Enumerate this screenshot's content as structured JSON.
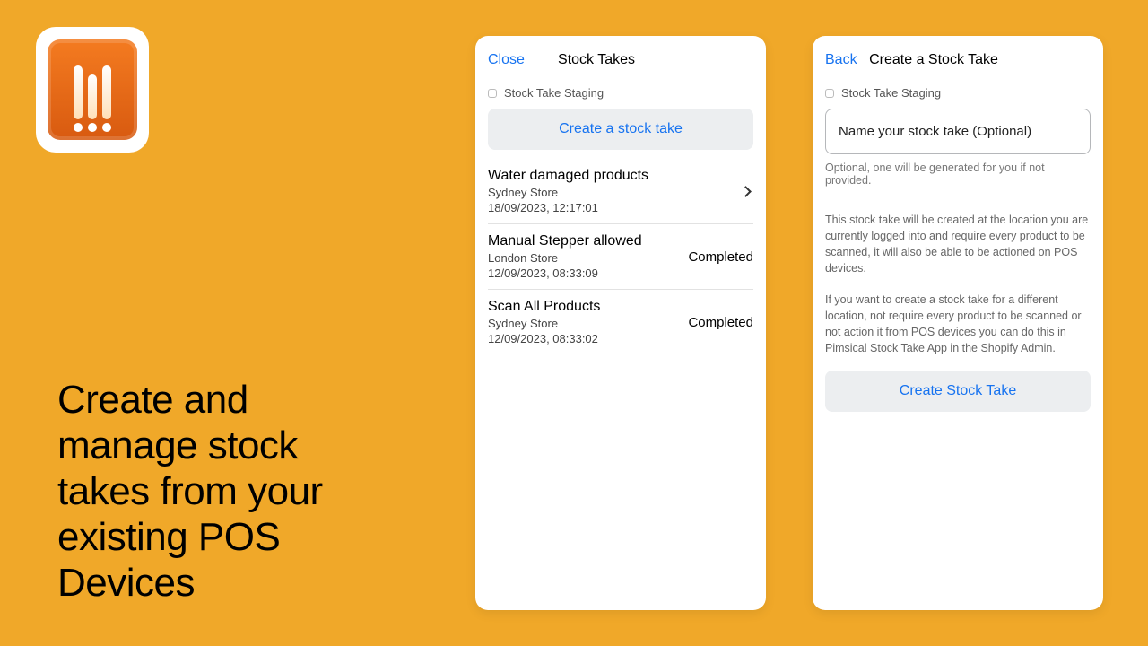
{
  "marketing": {
    "headline": "Create and manage stock takes from your existing POS Devices"
  },
  "left_phone": {
    "close_label": "Close",
    "title": "Stock Takes",
    "staging_label": "Stock Take Staging",
    "create_button": "Create a stock take",
    "items": [
      {
        "name": "Water damaged products",
        "store": "Sydney Store",
        "timestamp": "18/09/2023, 12:17:01",
        "status": "chevron"
      },
      {
        "name": "Manual Stepper allowed",
        "store": "London Store",
        "timestamp": "12/09/2023, 08:33:09",
        "status": "Completed"
      },
      {
        "name": "Scan All Products",
        "store": "Sydney Store",
        "timestamp": "12/09/2023, 08:33:02",
        "status": "Completed"
      }
    ]
  },
  "right_phone": {
    "back_label": "Back",
    "title": "Create a Stock Take",
    "staging_label": "Stock Take Staging",
    "name_placeholder": "Name your stock take (Optional)",
    "name_hint": "Optional, one will be generated for you if not provided.",
    "desc1": "This stock take will be created at the location you are currently logged into and require every product to be scanned, it will also be able to be actioned on POS devices.",
    "desc2": "If you want to create a stock take for a different location, not require every product to be scanned or not action it from POS devices you can do this in Pimsical Stock Take App in the Shopify Admin.",
    "create_button": "Create Stock Take"
  }
}
